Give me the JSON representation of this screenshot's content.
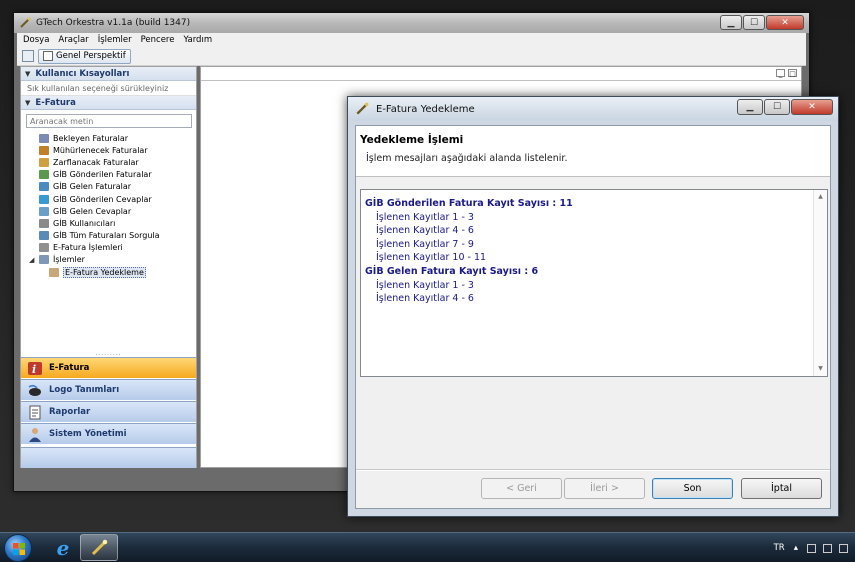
{
  "main_window": {
    "title": "GTech Orkestra v1.1a (build 1347)",
    "menu": [
      "Dosya",
      "Araçlar",
      "İşlemler",
      "Pencere",
      "Yardım"
    ],
    "toolbar": {
      "perspective_label": "Genel Perspektif"
    }
  },
  "left_panel": {
    "shortcuts_header": "Kullanıcı Kısayolları",
    "shortcuts_hint": "Sık kullanılan seçeneği sürükleyiniz",
    "efatura_header": "E-Fatura",
    "search_placeholder": "Aranacak metin",
    "tree": [
      {
        "label": "Bekleyen Faturalar",
        "color": "#7a8bb5"
      },
      {
        "label": "Mühürlenecek Faturalar",
        "color": "#c0802a"
      },
      {
        "label": "Zarflanacak Faturalar",
        "color": "#d0a040"
      },
      {
        "label": "GİB Gönderilen Faturalar",
        "color": "#5a9a4a"
      },
      {
        "label": "GİB Gelen Faturalar",
        "color": "#4a8ac0"
      },
      {
        "label": "GİB Gönderilen Cevaplar",
        "color": "#3a9ad0"
      },
      {
        "label": "GİB Gelen Cevaplar",
        "color": "#6aa0c8"
      },
      {
        "label": "GİB Kullanıcıları",
        "color": "#8a8a8a"
      },
      {
        "label": "GİB Tüm Faturaları Sorgula",
        "color": "#5a8ab8"
      },
      {
        "label": "E-Fatura İşlemleri",
        "color": "#909090"
      }
    ],
    "islemler_label": "İşlemler",
    "yedekleme_label": "E-Fatura Yedekleme",
    "nav": [
      {
        "label": "E-Fatura",
        "active": true
      },
      {
        "label": "Logo Tanımları",
        "active": false
      },
      {
        "label": "Raporlar",
        "active": false
      },
      {
        "label": "Sistem Yönetimi",
        "active": false
      }
    ]
  },
  "dialog": {
    "title": "E-Fatura Yedekleme",
    "header_title": "Yedekleme İşlemi",
    "header_desc": "İşlem mesajları aşağıdaki alanda listelenir.",
    "log": [
      {
        "text": "GİB Gönderilen Fatura Kayıt Sayısı : 11",
        "bold": true
      },
      {
        "text": "İşlenen Kayıtlar 1 - 3",
        "bold": false
      },
      {
        "text": "İşlenen Kayıtlar 4 - 6",
        "bold": false
      },
      {
        "text": "İşlenen Kayıtlar 7 - 9",
        "bold": false
      },
      {
        "text": "İşlenen Kayıtlar 10 - 11",
        "bold": false
      },
      {
        "text": "GİB Gelen Fatura Kayıt Sayısı : 6",
        "bold": true
      },
      {
        "text": "İşlenen Kayıtlar 1 - 3",
        "bold": false
      },
      {
        "text": "İşlenen Kayıtlar 4 - 6",
        "bold": false
      }
    ],
    "buttons": {
      "back": "< Geri",
      "next": "İleri >",
      "finish": "Son",
      "cancel": "İptal"
    }
  },
  "taskbar": {
    "language": "TR"
  }
}
